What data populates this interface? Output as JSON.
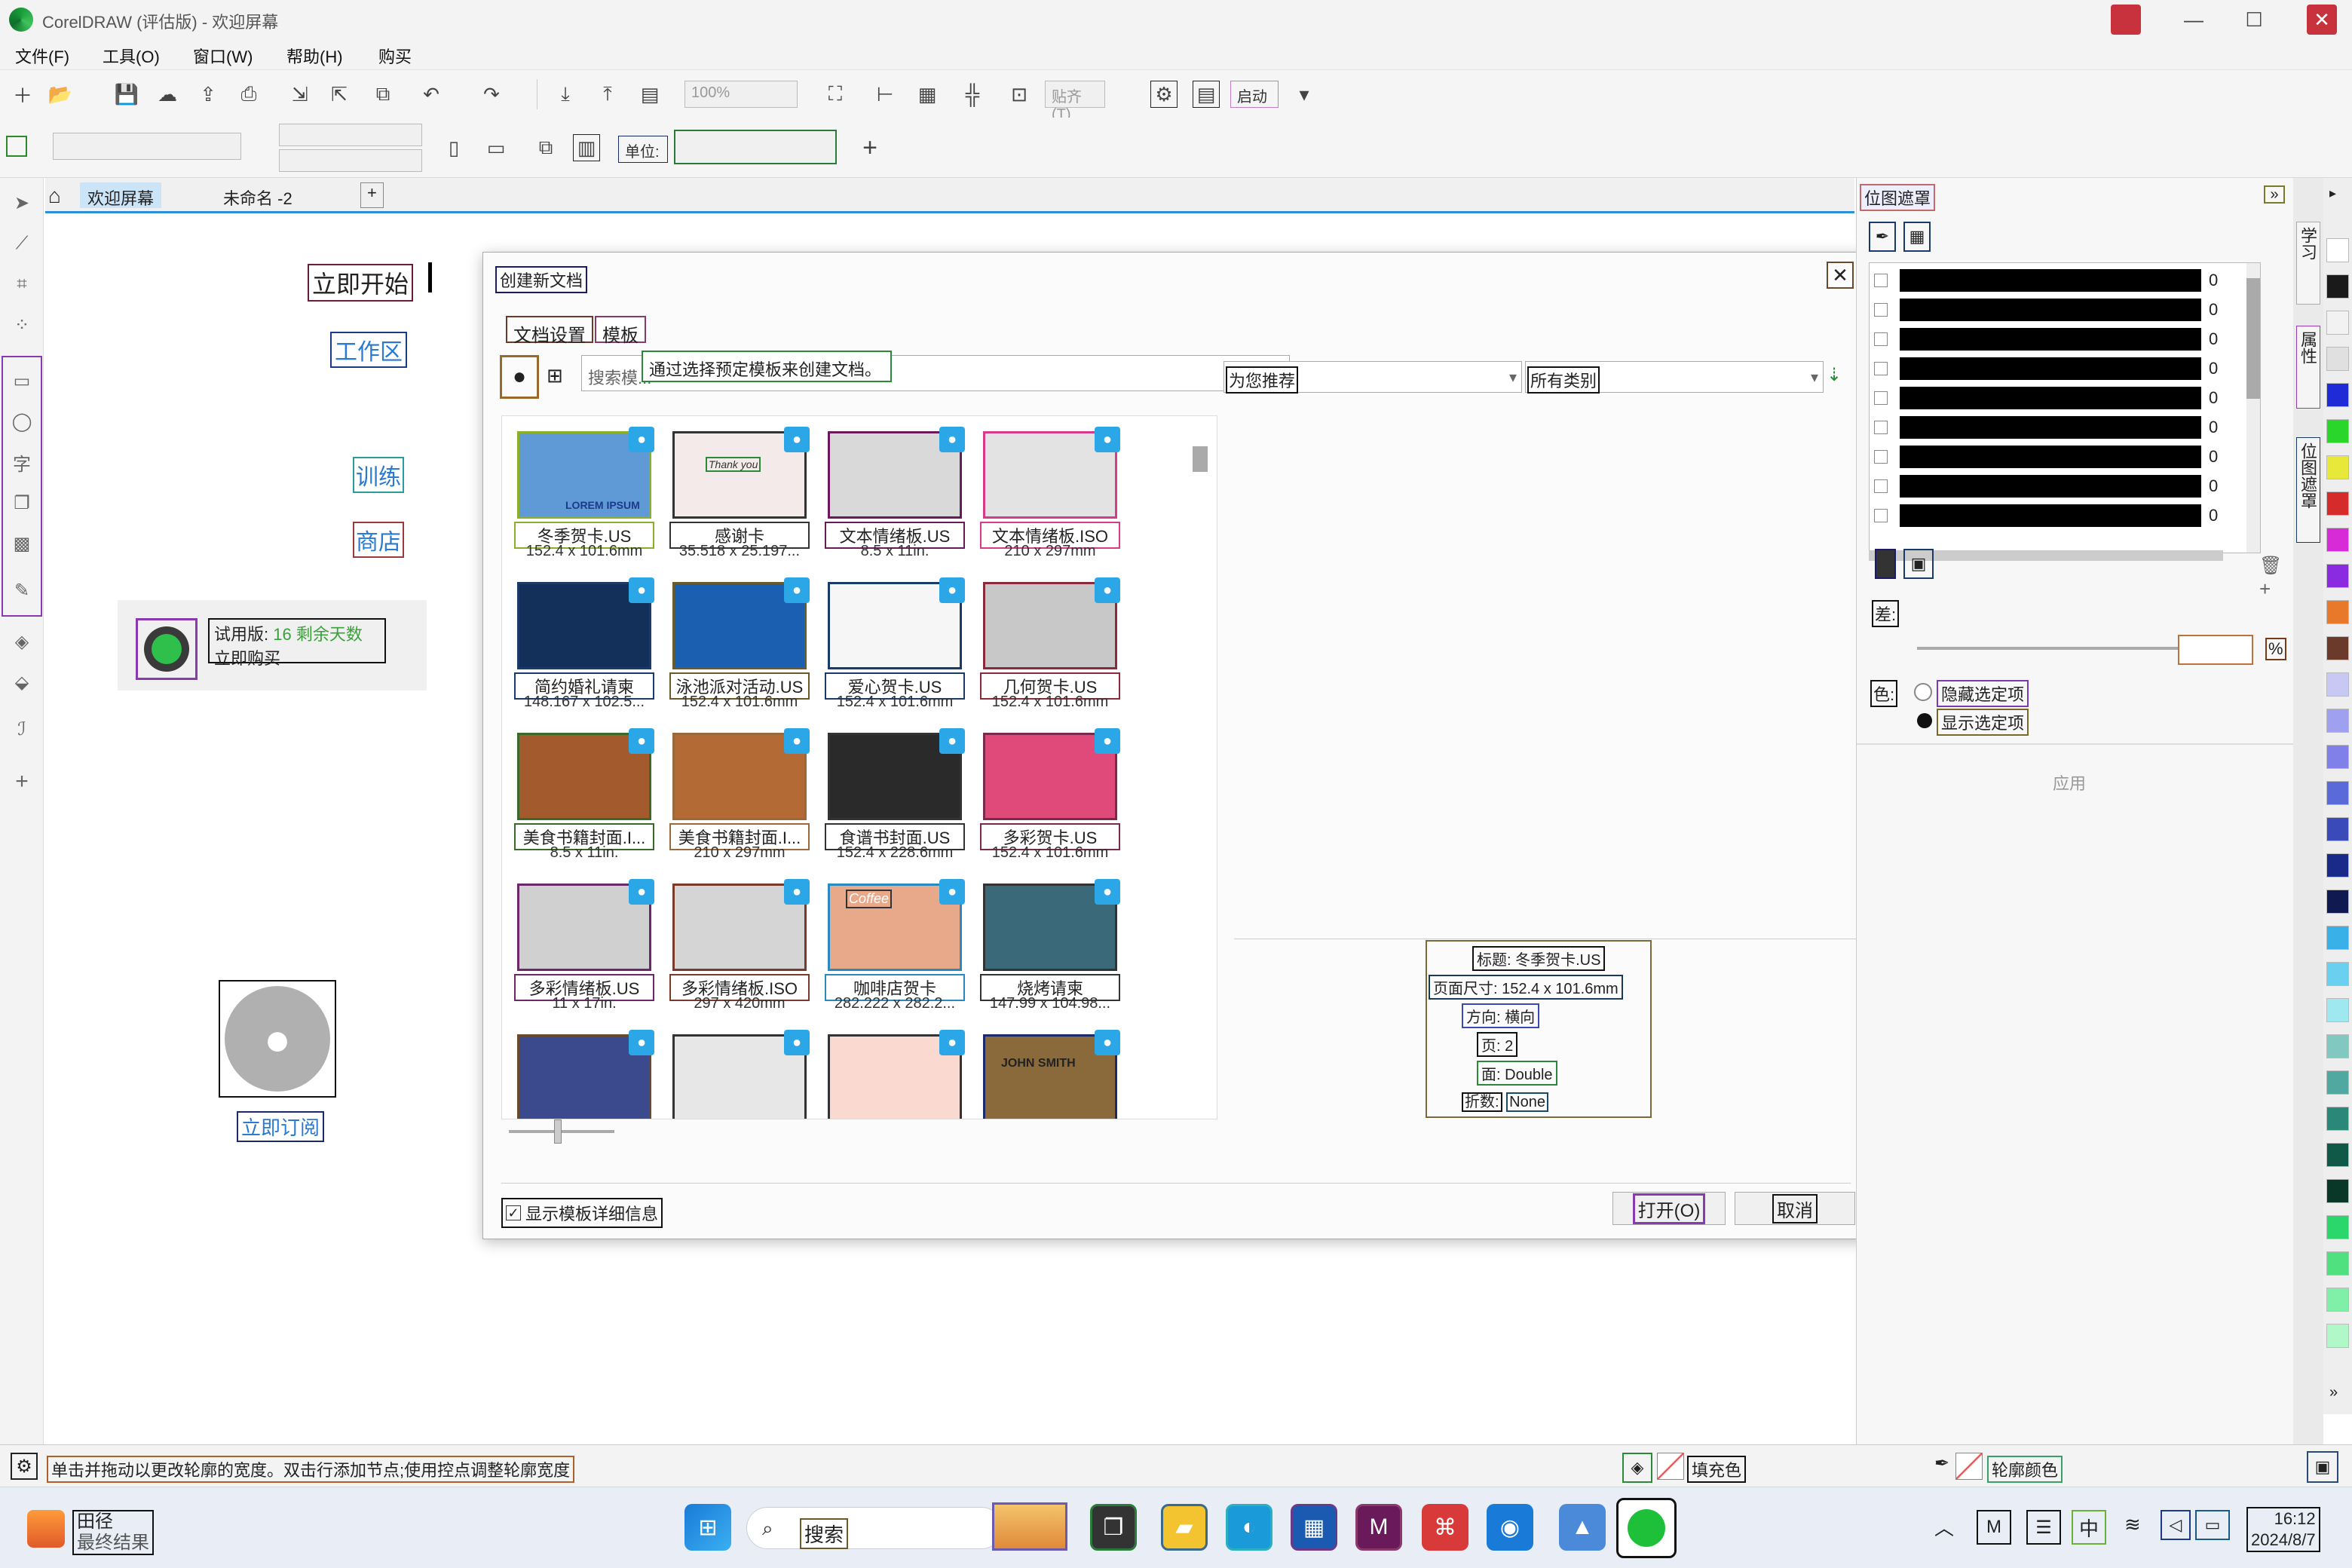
{
  "window": {
    "title": "CorelDRAW (评估版) - 欢迎屏幕",
    "min_label": "—",
    "max_label": "☐",
    "close_label": "✕"
  },
  "menu": [
    "文件(F)",
    "工具(O)",
    "窗口(W)",
    "帮助(H)",
    "购买"
  ],
  "toolbar": {
    "zoom_value": "100%",
    "snap_label": "贴齐(T)",
    "launch_label": "启动",
    "units_label": "单位:"
  },
  "doc_tabs": {
    "welcome": "欢迎屏幕",
    "untitled": "未命名 -2",
    "add": "+"
  },
  "welcome": {
    "get_started": "立即开始",
    "workspace": "工作区",
    "training": "训练",
    "store": "商店",
    "trial_label": "试用版:",
    "trial_days": "16 剩余天数",
    "buy_now": "立即购买",
    "subscribe": "立即订阅"
  },
  "dialog": {
    "title": "创建新文档",
    "tab_settings": "文档设置",
    "tab_templates": "模板",
    "tooltip": "通过选择预定模板来创建文档。",
    "search_placeholder": "搜索模...",
    "filter_recommend": "为您推荐",
    "filter_category": "所有类别",
    "show_details_label": "显示模板详细信息",
    "open_label": "打开(O)",
    "cancel_label": "取消",
    "details": {
      "title_label": "标题:",
      "title_value": "冬季贺卡.US",
      "size_label": "页面尺寸:",
      "size_value": "152.4 x 101.6mm",
      "orientation_label": "方向:",
      "orientation_value": "横向",
      "pages_label": "页:",
      "pages_value": "2",
      "sides_label": "面:",
      "sides_value": "Double",
      "fold_label": "折数:",
      "fold_value": "None"
    },
    "templates": [
      {
        "name": "冬季贺卡.US",
        "size": "152.4 x 101.6mm",
        "color": "#5f9ad6"
      },
      {
        "name": "感谢卡",
        "size": "35.518 x 25.197...",
        "color": "#f4eaea"
      },
      {
        "name": "文本情绪板.US",
        "size": "8.5 x 11in.",
        "color": "#d9d9d9"
      },
      {
        "name": "文本情绪板.ISO",
        "size": "210 x 297mm",
        "color": "#e3e3e3"
      },
      {
        "name": "简约婚礼请柬",
        "size": "148.167 x 102.5...",
        "color": "#12305a"
      },
      {
        "name": "泳池派对活动.US",
        "size": "152.4 x 101.6mm",
        "color": "#1b5fb0"
      },
      {
        "name": "爱心贺卡.US",
        "size": "152.4 x 101.6mm",
        "color": "#f6f6f6"
      },
      {
        "name": "几何贺卡.US",
        "size": "152.4 x 101.6mm",
        "color": "#c8c8c8"
      },
      {
        "name": "美食书籍封面.I...",
        "size": "8.5 x 11in.",
        "color": "#a35b2e"
      },
      {
        "name": "美食书籍封面.I...",
        "size": "210 x 297mm",
        "color": "#b46a34"
      },
      {
        "name": "食谱书封面.US",
        "size": "152.4 x 228.6mm",
        "color": "#2a2a2a"
      },
      {
        "name": "多彩贺卡.US",
        "size": "152.4 x 101.6mm",
        "color": "#e04a7a"
      },
      {
        "name": "多彩情绪板.US",
        "size": "11 x 17in.",
        "color": "#d0d0d0"
      },
      {
        "name": "多彩情绪板.ISO",
        "size": "297 x 420mm",
        "color": "#d5d5d5"
      },
      {
        "name": "咖啡店贺卡",
        "size": "282.222 x 282.2...",
        "color": "#e8a88a"
      },
      {
        "name": "烧烤请柬",
        "size": "147.99 x 104.98...",
        "color": "#3a6a7a"
      },
      {
        "name": "",
        "size": "",
        "color": "#3b4a8c"
      },
      {
        "name": "",
        "size": "",
        "color": "#e7e7e7"
      },
      {
        "name": "",
        "size": "",
        "color": "#f9d9d0"
      },
      {
        "name": "",
        "size": "",
        "color": "#8a6a3a"
      }
    ],
    "card_texts": {
      "thank": "Thank you",
      "lorem": "LOREM IPSUM",
      "coffee": "Coffee",
      "john": "JOHN SMITH"
    }
  },
  "docker": {
    "title": "位图遮罩",
    "diff_label": "差:",
    "color_label": "色:",
    "hide_selected": "隐藏选定项",
    "show_selected": "显示选定项",
    "apply_label": "应用",
    "percent": "%",
    "row_values": [
      "0",
      "0",
      "0",
      "0",
      "0",
      "0",
      "0",
      "0",
      "0"
    ]
  },
  "vtabs": [
    "学习",
    "属性",
    "位图遮罩"
  ],
  "palette": [
    "#ffffff",
    "#1a1a1a",
    "#f2f2f2",
    "#e0e0e0",
    "#1f2bd6",
    "#2bd62b",
    "#e8e83a",
    "#d62b2b",
    "#d62bd6",
    "#8a2be2",
    "#e8792b",
    "#6b3a2b",
    "#c8c8f5",
    "#a0a0f0",
    "#8080e8",
    "#5a6ad8",
    "#3a4ab8",
    "#1a2a88",
    "#101a50",
    "#3ab0e8",
    "#6ad0f0",
    "#a0e8f0",
    "#80c8c0",
    "#50a8a0",
    "#2a8878",
    "#105848",
    "#0a3828",
    "#2bd66b",
    "#50e080",
    "#80f0a8",
    "#b0f8c8"
  ],
  "statusbar": {
    "hint": "单击并拖动以更改轮廓的宽度。双击行添加节点;使用控点调整轮廓宽度",
    "fill_label": "填充色",
    "outline_label": "轮廓颜色"
  },
  "taskbar": {
    "weather_title": "田径",
    "weather_sub": "最终结果",
    "search_label": "搜索",
    "ime_label": "中",
    "time": "16:12",
    "date": "2024/8/7"
  }
}
